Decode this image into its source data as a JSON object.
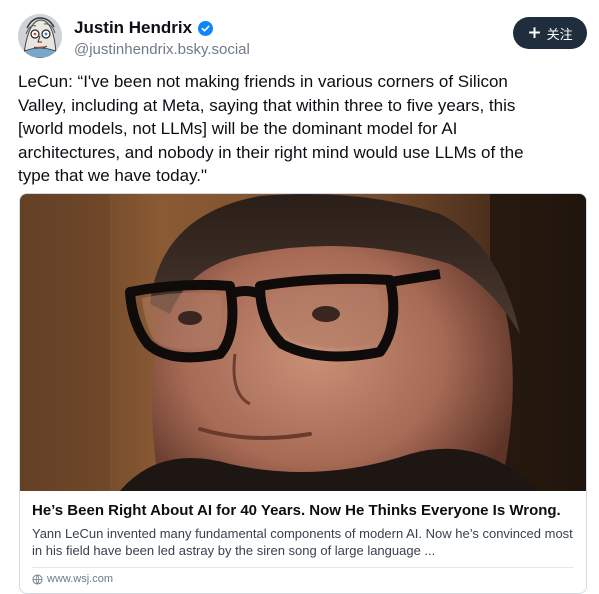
{
  "author": {
    "display_name": "Justin Hendrix",
    "handle": "@justinhendrix.bsky.social",
    "verified_color": "#1083fe",
    "avatar_icon": "sketch-portrait-avatar"
  },
  "follow_button": {
    "icon": "plus-icon",
    "label": "关注",
    "background": "#1f2d3d"
  },
  "post": {
    "text": "LeCun: “I've been not making friends in various corners of Silicon\nValley, including at Meta, saying that within three to five years, this\n[world models, not LLMs] will be the dominant model for AI\narchitectures, and nobody in their right mind would use LLMs of the\ntype that we have today.\""
  },
  "link_card": {
    "image_icon": "portrait-photo",
    "title": "He’s Been Right About AI for 40 Years. Now He Thinks Everyone Is Wrong.",
    "description": "Yann LeCun invented many fundamental components of modern AI. Now he’s convinced most in his field have been led astray by the siren song of large language ...",
    "domain": "www.wsj.com",
    "domain_icon": "globe-icon"
  }
}
